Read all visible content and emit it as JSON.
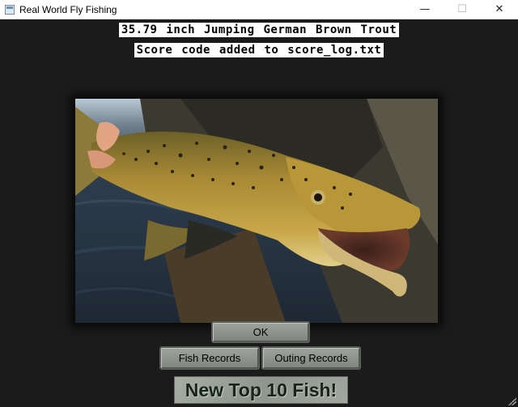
{
  "window": {
    "title": "Real World Fly Fishing",
    "minimize_glyph": "—",
    "maximize_glyph": "☐",
    "close_glyph": "✕"
  },
  "result": {
    "catch_line": "35.79 inch Jumping German Brown Trout",
    "log_line": "Score code added to score_log.txt"
  },
  "photo": {
    "subject_icon": "trout-photo",
    "colors": {
      "fish_body": "#a4802f",
      "water": "#2b3a4a",
      "sky": "#b8c8d8"
    }
  },
  "buttons": {
    "ok": "OK",
    "fish_records": "Fish Records",
    "outing_records": "Outing Records"
  },
  "banner": {
    "text": "New Top 10 Fish!"
  }
}
